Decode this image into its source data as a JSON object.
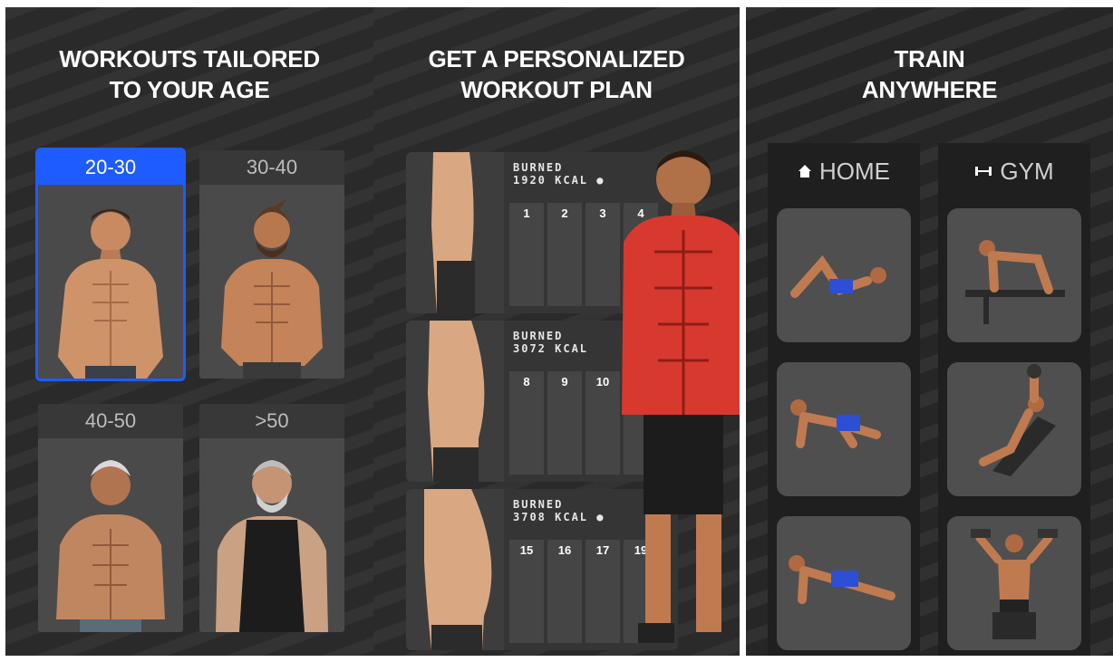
{
  "panels": {
    "age": {
      "title_line1": "WORKOUTS TAILORED",
      "title_line2": "TO YOUR AGE",
      "cards": [
        {
          "label": "20-30",
          "selected": true
        },
        {
          "label": "30-40",
          "selected": false
        },
        {
          "label": "40-50",
          "selected": false
        },
        {
          "label": ">50",
          "selected": false
        }
      ]
    },
    "plan": {
      "title_line1": "GET A PERSONALIZED",
      "title_line2": "WORKOUT PLAN",
      "cards": [
        {
          "burned": "BURNED",
          "kcal": "1920 KCAL",
          "days": [
            "1",
            "2",
            "3",
            "4"
          ]
        },
        {
          "burned": "BURNED",
          "kcal": "3072 KCAL",
          "days": [
            "8",
            "9",
            "10",
            ""
          ]
        },
        {
          "burned": "BURNED",
          "kcal": "3708 KCAL",
          "days": [
            "15",
            "16",
            "17",
            "19"
          ]
        }
      ]
    },
    "train": {
      "title_line1": "TRAIN",
      "title_line2": "ANYWHERE",
      "tabs": [
        {
          "label": "HOME",
          "icon": "home-icon"
        },
        {
          "label": "GYM",
          "icon": "dumbbell-icon"
        }
      ]
    }
  },
  "colors": {
    "accent": "#1e5cff",
    "panel_bg": "#2a2a2a",
    "card_bg": "#4a4a4a"
  }
}
